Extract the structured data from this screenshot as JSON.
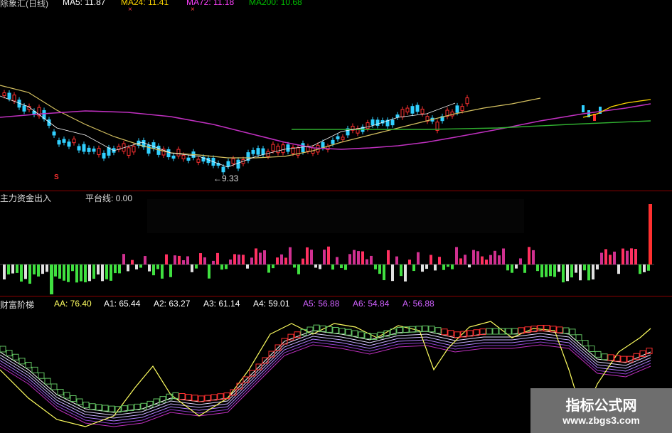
{
  "main_pane": {
    "title": "除象汇(日线)",
    "ma_items": [
      {
        "text": "MA5: 11.87",
        "color": "#ffffff"
      },
      {
        "text": "MA24: 11.41",
        "color": "#ffd700"
      },
      {
        "text": "MA72: 11.18",
        "color": "#ff40ff"
      },
      {
        "text": "MA200: 10.68",
        "color": "#00c000"
      }
    ],
    "low_label": "←9.33",
    "marker_s": "S",
    "marker_x1": "×",
    "marker_x2": "×"
  },
  "fund_pane": {
    "title": "主力资金出入",
    "platform_label": "平台线: 0.00"
  },
  "wealth_pane": {
    "title": "财富阶梯",
    "values": [
      {
        "text": "AA: 76.40",
        "color": "#ffff60"
      },
      {
        "text": "A1: 65.44",
        "color": "#ffffff"
      },
      {
        "text": "A2: 63.27",
        "color": "#ffffff"
      },
      {
        "text": "A3: 61.14",
        "color": "#ffffff"
      },
      {
        "text": "A4: 59.01",
        "color": "#ffffff"
      },
      {
        "text": "A5: 56.88",
        "color": "#d060ff"
      },
      {
        "text": "A6: 54.84",
        "color": "#d060ff"
      },
      {
        "text": "A: 56.88",
        "color": "#d060ff"
      }
    ]
  },
  "watermark": {
    "line1": "指标公式网",
    "line2": "www.zbgs3.com"
  },
  "colors": {
    "up": "#ff3030",
    "down": "#30d0ff",
    "inflow": "#ff3060",
    "outflow": "#40e040",
    "ma24": "#d4c060",
    "ma72": "#c030c0",
    "ma200": "#30b030"
  }
}
